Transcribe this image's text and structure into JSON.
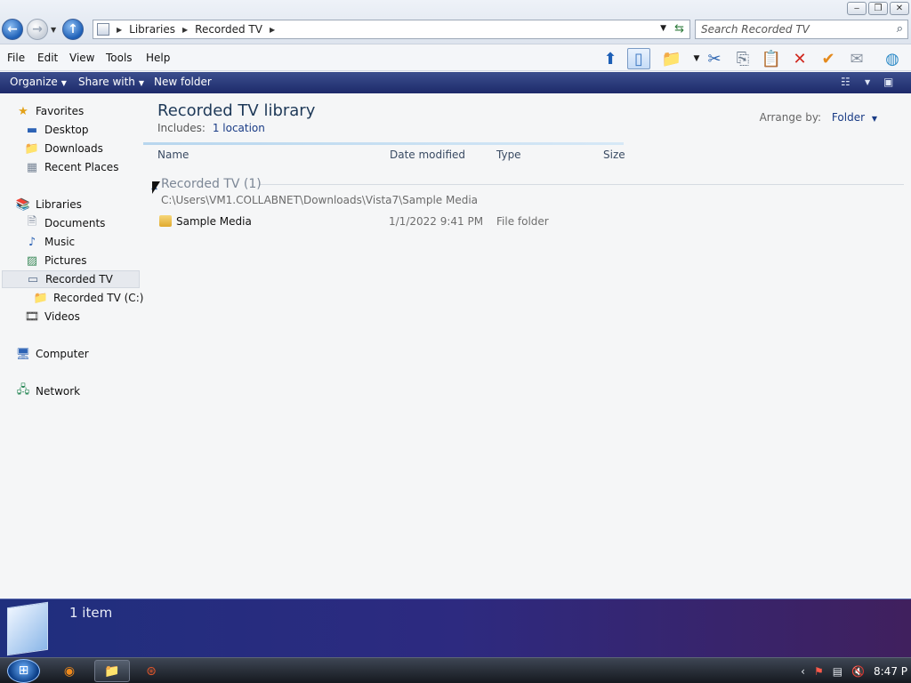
{
  "window": {
    "min_label": "‒",
    "max_label": "❐",
    "close_label": "✕"
  },
  "address": {
    "crumbs": [
      "Libraries",
      "Recorded TV"
    ],
    "search_placeholder": "Search Recorded TV"
  },
  "menu": {
    "items": [
      "File",
      "Edit",
      "View",
      "Tools",
      "Help"
    ]
  },
  "commandbar": {
    "organize": "Organize",
    "share_with": "Share with",
    "new_folder": "New folder"
  },
  "nav": {
    "favorites": "Favorites",
    "desktop": "Desktop",
    "downloads": "Downloads",
    "recent_places": "Recent Places",
    "libraries": "Libraries",
    "documents": "Documents",
    "music": "Music",
    "pictures": "Pictures",
    "recorded_tv": "Recorded TV",
    "recorded_tv_c": "Recorded TV (C:)",
    "videos": "Videos",
    "computer": "Computer",
    "network": "Network"
  },
  "content": {
    "library_title": "Recorded TV library",
    "includes_label": "Includes:",
    "includes_link": "1 location",
    "arrange_label": "Arrange by:",
    "arrange_value": "Folder",
    "columns": {
      "name": "Name",
      "date": "Date modified",
      "type": "Type",
      "size": "Size"
    },
    "group": {
      "title": "Recorded TV (1)",
      "path": "C:\\Users\\VM1.COLLABNET\\Downloads\\Vista7\\Sample Media"
    },
    "rows": [
      {
        "name": "Sample Media",
        "date": "1/1/2022 9:41 PM",
        "type": "File folder",
        "size": ""
      }
    ]
  },
  "details": {
    "count": "1 item"
  },
  "taskbar": {
    "clock": "8:47 P"
  }
}
